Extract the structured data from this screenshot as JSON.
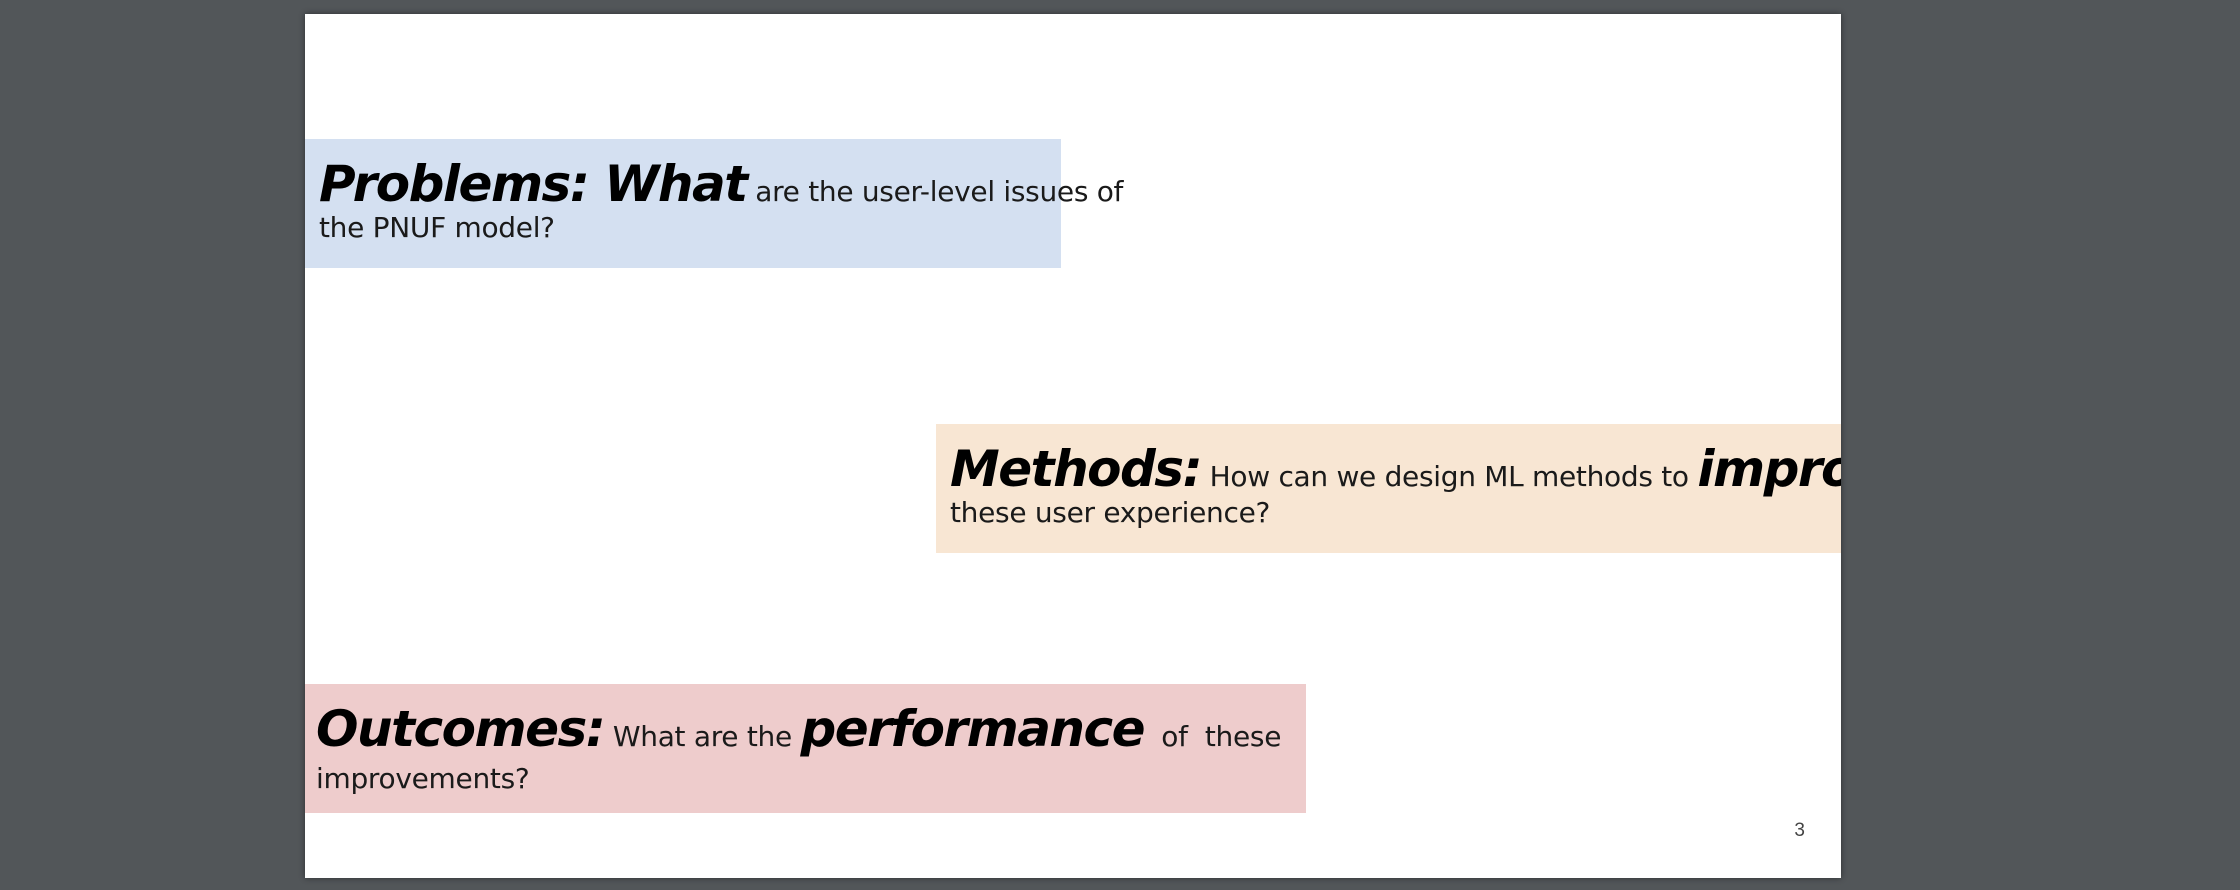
{
  "slide": {
    "page_number": "3",
    "problems": {
      "keyword": "Problems: What",
      "text_inline": " are the user-level issues of",
      "text_line2": "the PNUF model?",
      "bg_color": "#d4e0f1"
    },
    "methods": {
      "keyword": "Methods:",
      "text_inline": " How can we design ML methods to ",
      "keyword2": "improve",
      "text_line2": "these user experience?",
      "bg_color": "#f8e6d3"
    },
    "outcomes": {
      "keyword": "Outcomes:",
      "text_inline": " What are the ",
      "keyword2": "performance",
      "text_inline2": "  of  these",
      "text_line2": "improvements?",
      "bg_color": "#eecccc"
    }
  }
}
